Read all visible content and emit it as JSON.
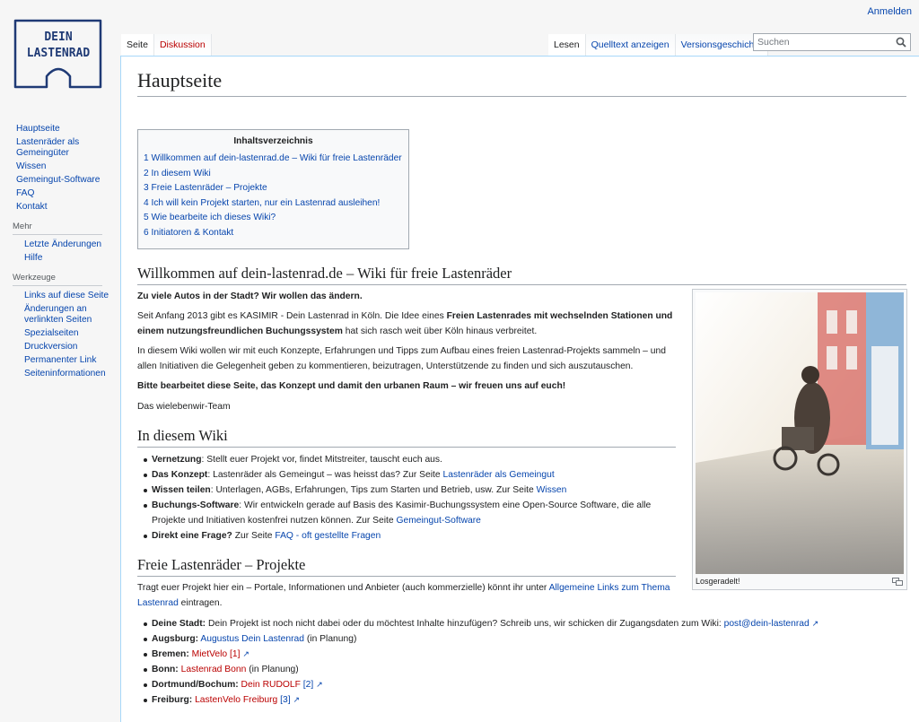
{
  "header": {
    "login": "Anmelden",
    "logo_line1": "DEIN",
    "logo_line2": "LASTENRAD"
  },
  "tabs": {
    "left": [
      "Seite",
      "Diskussion"
    ],
    "right": [
      "Lesen",
      "Quelltext anzeigen",
      "Versionsgeschichte"
    ]
  },
  "search": {
    "placeholder": "Suchen"
  },
  "sidebar": {
    "nav": [
      "Hauptseite",
      "Lastenräder als Gemeingüter",
      "Wissen",
      "Gemeingut-Software",
      "FAQ",
      "Kontakt"
    ],
    "more_heading": "Mehr",
    "more": [
      "Letzte Änderungen",
      "Hilfe"
    ],
    "tools_heading": "Werkzeuge",
    "tools": [
      "Links auf diese Seite",
      "Änderungen an verlinkten Seiten",
      "Spezialseiten",
      "Druckversion",
      "Permanenter Link",
      "Seiteninformationen"
    ]
  },
  "page": {
    "title": "Hauptseite",
    "toc_title": "Inhaltsverzeichnis",
    "toc": [
      "1 Willkommen auf dein-lastenrad.de – Wiki für freie Lastenräder",
      "2 In diesem Wiki",
      "3 Freie Lastenräder – Projekte",
      "4 Ich will kein Projekt starten, nur ein Lastenrad ausleihen!",
      "5 Wie bearbeite ich dieses Wiki?",
      "6 Initiatoren & Kontakt"
    ],
    "h_willkommen": "Willkommen auf dein-lastenrad.de – Wiki für freie Lastenräder",
    "p1": "Zu viele Autos in der Stadt? Wir wollen das ändern.",
    "p2a": "Seit Anfang 2013 gibt es KASIMIR - Dein Lastenrad in Köln. Die Idee eines ",
    "p2b": "Freien Lastenrades mit wechselnden Stationen und einem nutzungsfreundlichen Buchungssystem",
    "p2c": " hat sich rasch weit über Köln hinaus verbreitet.",
    "p3": "In diesem Wiki wollen wir mit euch Konzepte, Erfahrungen und Tipps zum Aufbau eines freien Lastenrad-Projekts sammeln – und allen Initiativen die Gelegenheit geben zu kommentieren, beizutragen, Unterstützende zu finden und sich auszutauschen.",
    "p4": "Bitte bearbeitet diese Seite, das Konzept und damit den urbanen Raum – wir freuen uns auf euch!",
    "p5": "Das wielebenwir-Team",
    "thumb_caption": "Losgeradelt!",
    "h_in_diesem": "In diesem Wiki",
    "wiki_items": [
      {
        "b": "Vernetzung",
        "t": ": Stellt euer Projekt vor, findet Mitstreiter, tauscht euch aus.",
        "link": ""
      },
      {
        "b": "Das Konzept",
        "t": ": Lastenräder als Gemeingut – was heisst das? Zur Seite ",
        "link": "Lastenräder als Gemeingut"
      },
      {
        "b": "Wissen teilen",
        "t": ": Unterlagen, AGBs, Erfahrungen, Tips zum Starten und Betrieb, usw. Zur Seite ",
        "link": "Wissen"
      },
      {
        "b": "Buchungs-Software",
        "t": ": Wir entwickeln gerade auf Basis des Kasimir-Buchungssystem eine Open-Source Software, die alle Projekte und Initiativen kostenfrei nutzen können. Zur Seite ",
        "link": "Gemeingut-Software"
      },
      {
        "b": "Direkt eine Frage?",
        "t": " Zur Seite ",
        "link": "FAQ - oft gestellte Fragen"
      }
    ],
    "h_freie": "Freie Lastenräder – Projekte",
    "freie_text": "Tragt euer Projekt hier ein – Portale, Informationen und Anbieter (auch kommerzielle) könnt ihr unter ",
    "freie_link": "Allgemeine Links zum Thema Lastenrad",
    "freie_tail": " eintragen.",
    "projects": [
      {
        "city": "Deine Stadt:",
        "text": " Dein Projekt ist noch nicht dabei oder du möchtest Inhalte hinzufügen? Schreib uns, wir schicken dir Zugangsdaten zum Wiki: ",
        "link": "post@dein-lastenrad",
        "ref": "",
        "tail": ""
      },
      {
        "city": "Augsburg:",
        "text": " ",
        "link": "Augustus Dein Lastenrad",
        "ref": "",
        "tail": " (in Planung)"
      },
      {
        "city": "Bremen:",
        "text": " ",
        "link": "MietVelo",
        "ref": "[1]",
        "tail": ""
      },
      {
        "city": "Bonn:",
        "text": " ",
        "link": "Lastenrad Bonn",
        "ref": "",
        "tail": " (in Planung)"
      },
      {
        "city": "Dortmund/Bochum:",
        "text": " ",
        "link": "Dein RUDOLF",
        "ref": "[2]",
        "tail": ""
      },
      {
        "city": "Freiburg:",
        "text": " ",
        "link": "LastenVelo Freiburg",
        "ref": "[3]",
        "tail": ""
      }
    ]
  },
  "colors": {
    "link": "#0645ad",
    "new_link": "#ba0000",
    "border": "#a7d7f9"
  }
}
